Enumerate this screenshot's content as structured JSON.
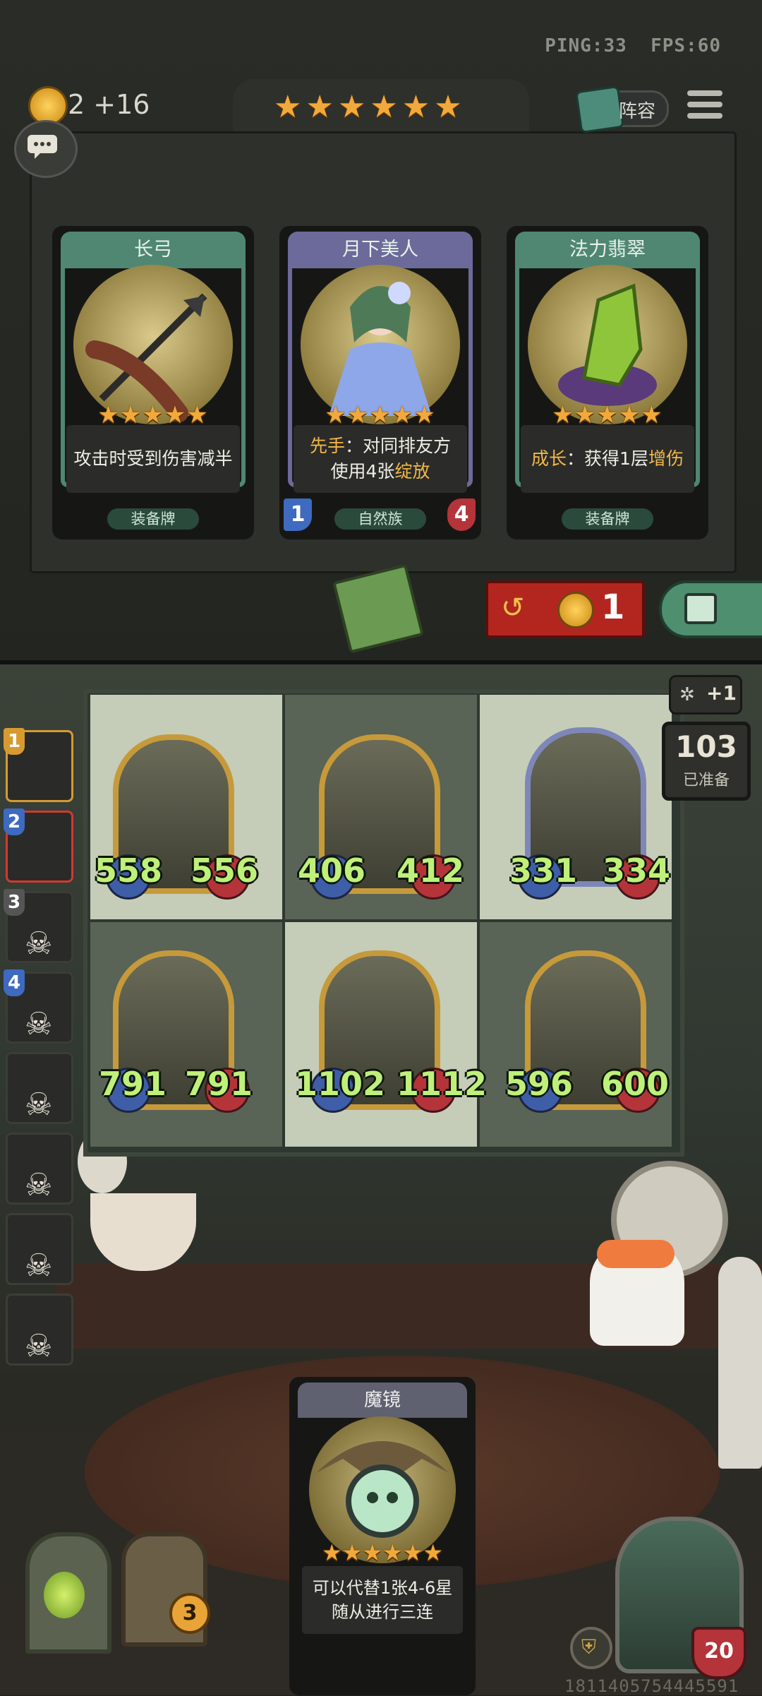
{
  "status": {
    "ping": "PING:33",
    "fps": "FPS:60"
  },
  "gold": {
    "amount": "2",
    "income": "+16"
  },
  "tavern": {
    "stars": "★★★★★★"
  },
  "lineup_button": {
    "label": "阵容"
  },
  "shop_cards": [
    {
      "name": "长弓",
      "stars": "★★★★★",
      "desc": "攻击时受到伤害减半",
      "type": "装备牌"
    },
    {
      "name": "月下美人",
      "stars": "★★★★★",
      "desc_keyword": "先手",
      "desc_rest1": "：对同排友方",
      "desc_line2_a": "使用4张",
      "desc_keyword2": "绽放",
      "type": "自然族",
      "attack": "1",
      "health": "4"
    },
    {
      "name": "法力翡翠",
      "stars": "★★★★★",
      "desc_keyword": "成长",
      "desc_rest1": "：获得1层",
      "desc_keyword2": "增伤",
      "type": "装备牌"
    }
  ],
  "refresh": {
    "cost": "1"
  },
  "ready": {
    "count": "103",
    "label": "已准备",
    "bonus": "+1"
  },
  "board": [
    {
      "attack": "558",
      "health": "556"
    },
    {
      "attack": "406",
      "health": "412"
    },
    {
      "attack": "331",
      "health": "334"
    },
    {
      "attack": "791",
      "health": "791"
    },
    {
      "attack": "1102",
      "health": "1112"
    },
    {
      "attack": "596",
      "health": "600"
    }
  ],
  "players": [
    {
      "rank": "1"
    },
    {
      "rank": "2"
    },
    {
      "rank": "3"
    },
    {
      "rank": "4"
    },
    {
      "rank": ""
    },
    {
      "rank": ""
    },
    {
      "rank": ""
    },
    {
      "rank": ""
    }
  ],
  "hand_card": {
    "name": "魔镜",
    "stars": "★★★★★★",
    "desc_line1": "可以代替1张4-6星",
    "desc_line2": "随从进行三连"
  },
  "chest_count": "3",
  "hero_health": "20",
  "seed": "1811405754445591"
}
